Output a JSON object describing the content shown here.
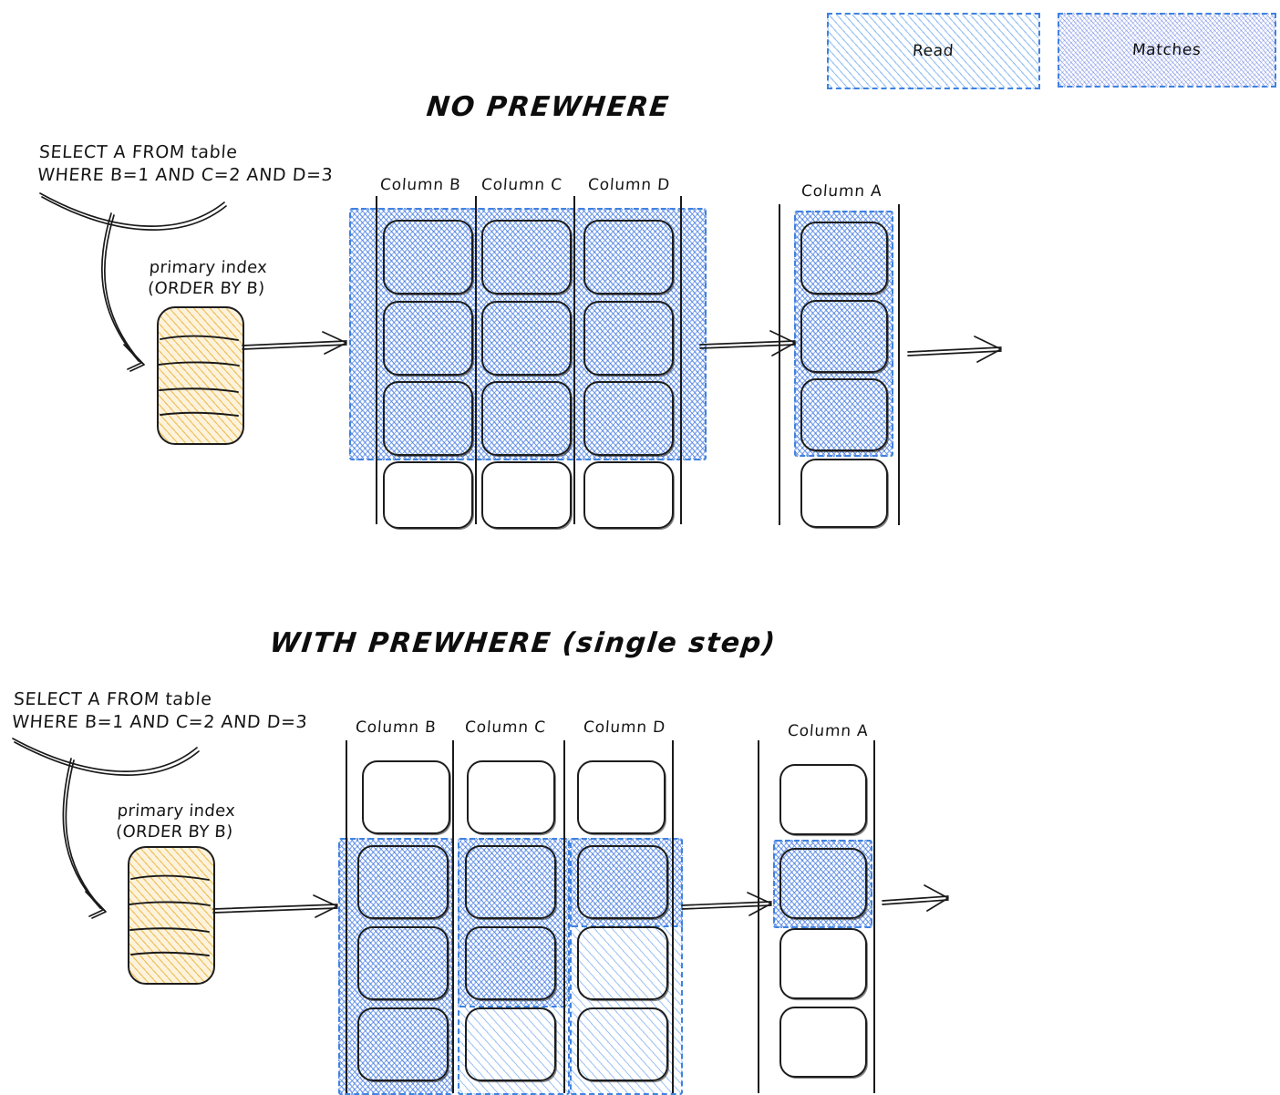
{
  "legend": {
    "items": [
      {
        "label": "Read",
        "style": "read-hatch",
        "color": "#5fa0ee"
      },
      {
        "label": "Matches",
        "style": "matches-hatch",
        "color": "#5670de"
      }
    ]
  },
  "sections": [
    {
      "id": "no-prewhere",
      "title": "NO PREWHERE",
      "query": "SELECT A FROM table\nWHERE B=1 AND C=2 AND D=3",
      "index": {
        "label": "primary index\n(ORDER BY B)",
        "color": "#e8b036",
        "stripes": 5
      },
      "filter_columns": [
        {
          "name": "Column B",
          "rows": [
            "match",
            "match",
            "match",
            "none"
          ]
        },
        {
          "name": "Column C",
          "rows": [
            "match",
            "match",
            "match",
            "none"
          ]
        },
        {
          "name": "Column D",
          "rows": [
            "match",
            "match",
            "match",
            "none"
          ]
        }
      ],
      "result_column": {
        "name": "Column A",
        "rows": [
          "match",
          "match",
          "match",
          "none"
        ]
      }
    },
    {
      "id": "with-prewhere-single-step",
      "title": "WITH PREWHERE (single step)",
      "query": "SELECT A FROM table\nWHERE B=1 AND C=2 AND D=3",
      "index": {
        "label": "primary index\n(ORDER BY B)",
        "color": "#e8b036",
        "stripes": 5
      },
      "filter_columns": [
        {
          "name": "Column B",
          "rows": [
            "none",
            "match",
            "match",
            "match"
          ]
        },
        {
          "name": "Column C",
          "rows": [
            "none",
            "match",
            "match",
            "read"
          ]
        },
        {
          "name": "Column D",
          "rows": [
            "none",
            "match",
            "read",
            "read"
          ]
        }
      ],
      "result_column": {
        "name": "Column A",
        "rows": [
          "none",
          "match",
          "none",
          "none"
        ]
      }
    }
  ]
}
